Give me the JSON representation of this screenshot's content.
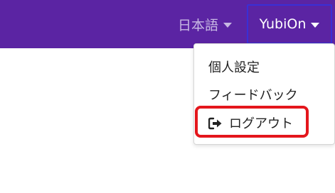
{
  "navbar": {
    "background_color": "#5b24a3",
    "language_label": "日本語",
    "language_caret_icon": "caret-down-icon",
    "user_label": "YubiOn",
    "user_caret_icon": "caret-down-icon"
  },
  "user_menu": {
    "items": [
      {
        "label": "個人設定"
      },
      {
        "label": "フィードバック"
      },
      {
        "label": "ログアウト",
        "icon": "sign-out-icon"
      }
    ],
    "highlight_color": "#e4161c"
  }
}
